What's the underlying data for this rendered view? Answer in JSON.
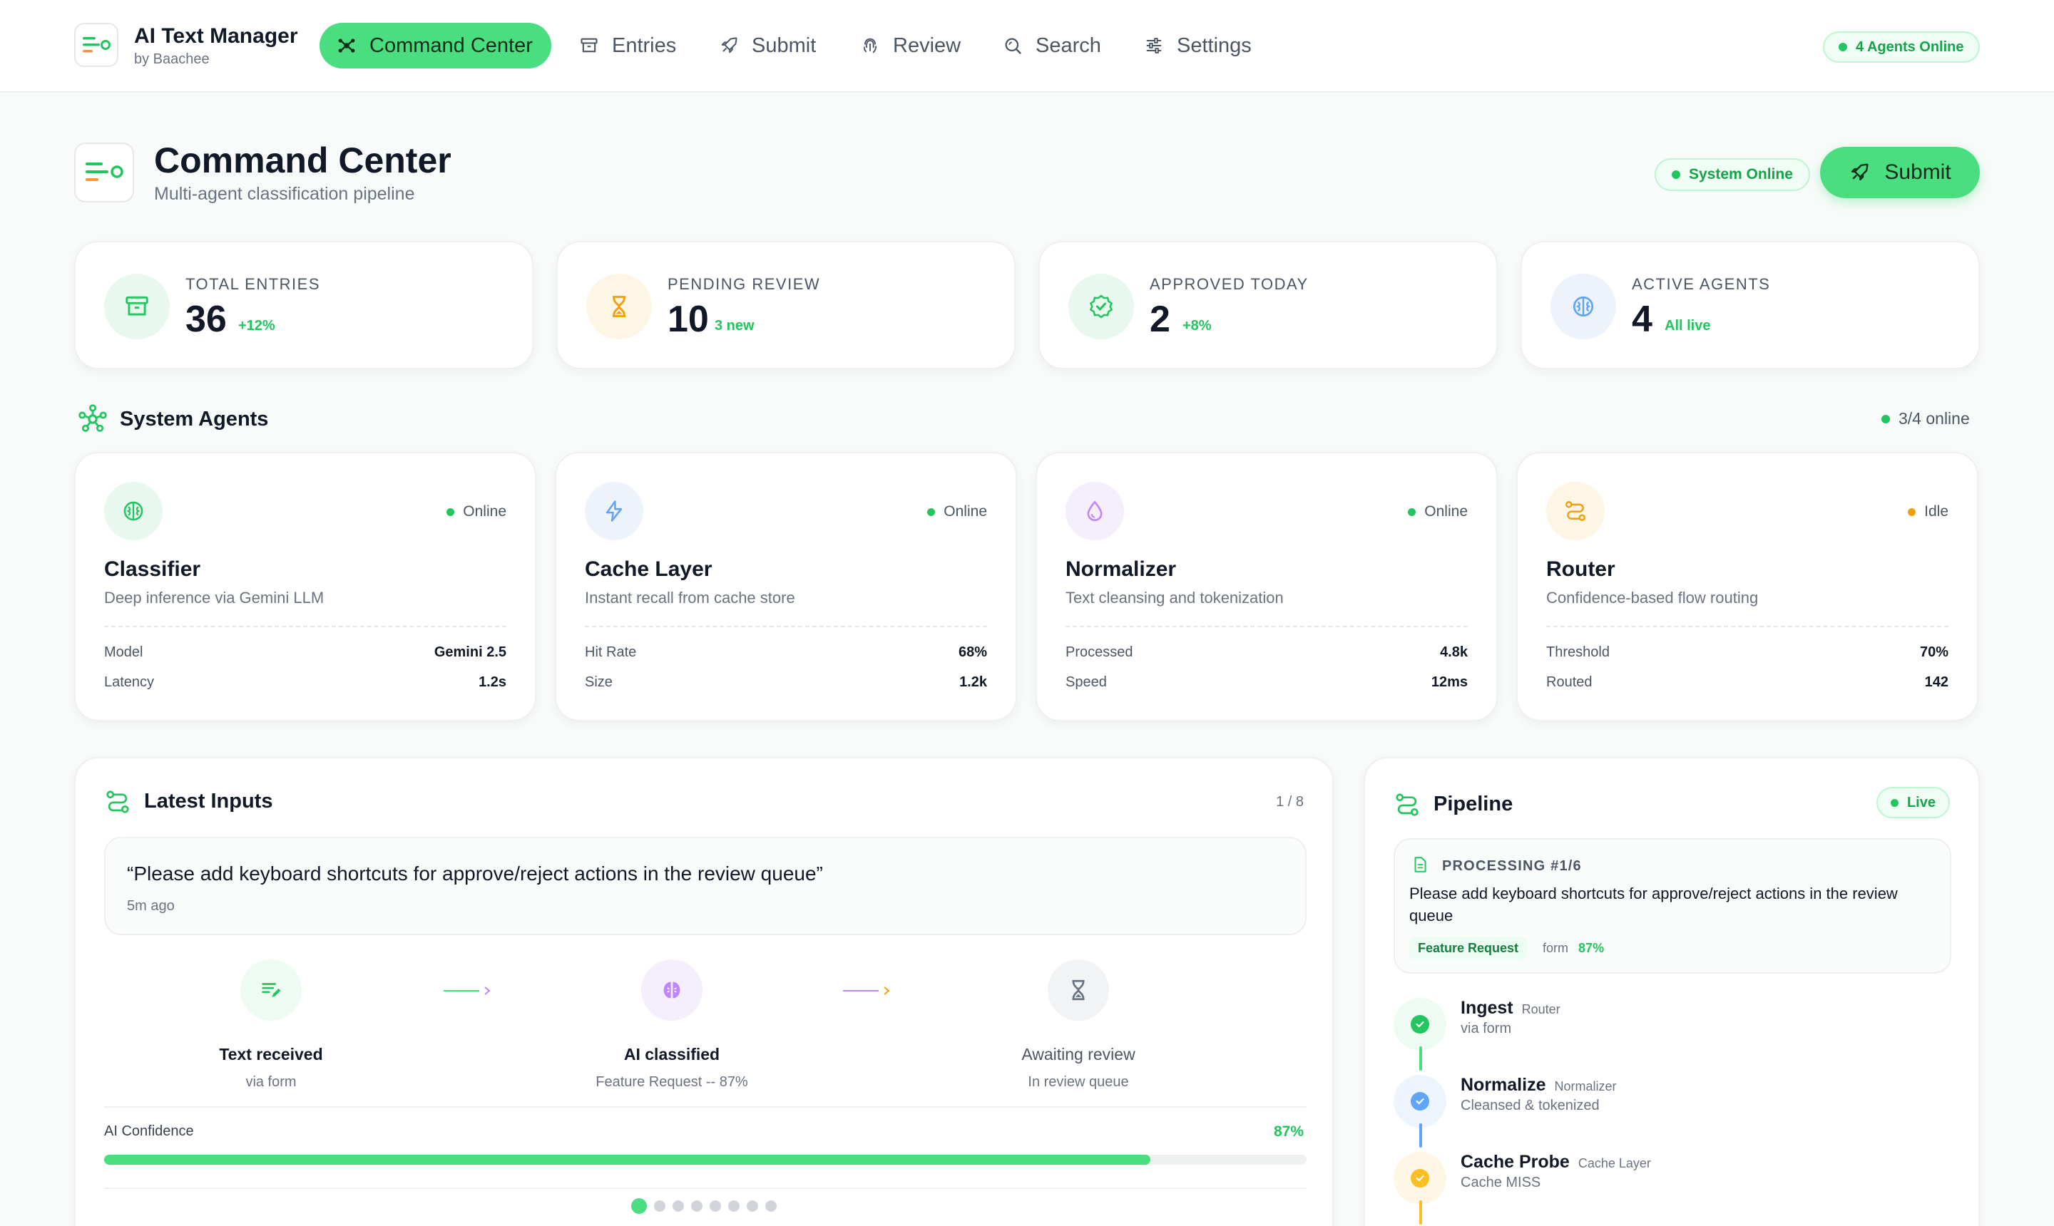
{
  "app": {
    "title": "AI Text Manager",
    "subtitle": "by Baachee"
  },
  "nav": {
    "items": [
      {
        "label": "Command Center",
        "icon": "hub-icon",
        "active": true
      },
      {
        "label": "Entries",
        "icon": "archive-icon"
      },
      {
        "label": "Submit",
        "icon": "rocket-icon"
      },
      {
        "label": "Review",
        "icon": "fingerprint-icon"
      },
      {
        "label": "Search",
        "icon": "search-icon"
      },
      {
        "label": "Settings",
        "icon": "sliders-icon"
      }
    ],
    "agents_online": "4 Agents Online"
  },
  "header": {
    "title": "Command Center",
    "subtitle": "Multi-agent classification pipeline",
    "system_status": "System Online",
    "submit_label": "Submit"
  },
  "stats": [
    {
      "label": "TOTAL ENTRIES",
      "value": "36",
      "delta": "+12%",
      "icon": "archive-icon"
    },
    {
      "label": "PENDING REVIEW",
      "value": "10",
      "delta": "3 new",
      "icon": "hourglass-icon"
    },
    {
      "label": "APPROVED TODAY",
      "value": "2",
      "delta": "+8%",
      "icon": "badge-check-icon"
    },
    {
      "label": "ACTIVE AGENTS",
      "value": "4",
      "delta": "All live",
      "icon": "brain-icon"
    }
  ],
  "agents_section": {
    "title": "System Agents",
    "online_count": "3/4 online"
  },
  "agents": [
    {
      "name": "Classifier",
      "desc": "Deep inference via Gemini LLM",
      "status": "Online",
      "status_color": "#22c55e",
      "rows": [
        {
          "k": "Model",
          "v": "Gemini 2.5"
        },
        {
          "k": "Latency",
          "v": "1.2s"
        }
      ]
    },
    {
      "name": "Cache Layer",
      "desc": "Instant recall from cache store",
      "status": "Online",
      "status_color": "#22c55e",
      "rows": [
        {
          "k": "Hit Rate",
          "v": "68%"
        },
        {
          "k": "Size",
          "v": "1.2k"
        }
      ]
    },
    {
      "name": "Normalizer",
      "desc": "Text cleansing and tokenization",
      "status": "Online",
      "status_color": "#22c55e",
      "rows": [
        {
          "k": "Processed",
          "v": "4.8k"
        },
        {
          "k": "Speed",
          "v": "12ms"
        }
      ]
    },
    {
      "name": "Router",
      "desc": "Confidence-based flow routing",
      "status": "Idle",
      "status_color": "#f59e0b",
      "rows": [
        {
          "k": "Threshold",
          "v": "70%"
        },
        {
          "k": "Routed",
          "v": "142"
        }
      ]
    }
  ],
  "latest": {
    "title": "Latest Inputs",
    "pager": "1 / 8",
    "quote": "“Please add keyboard shortcuts for approve/reject actions in the review queue”",
    "time": "5m ago",
    "steps": [
      {
        "title": "Text received",
        "sub": "via form"
      },
      {
        "title": "AI classified",
        "sub": "Feature Request -- 87%"
      },
      {
        "title": "Awaiting review",
        "sub": "In review queue"
      }
    ],
    "confidence_label": "AI Confidence",
    "confidence_value": "87%",
    "confidence": 0.87,
    "page_count": 8,
    "current_page": 1
  },
  "pipeline": {
    "title": "Pipeline",
    "live": "Live",
    "processing_label": "PROCESSING #1/6",
    "processing_text": "Please add keyboard shortcuts for approve/reject actions in the review queue",
    "tag": "Feature Request",
    "source": "form",
    "score": "87%",
    "stages": [
      {
        "name": "Ingest",
        "agent": "Router",
        "sub": "via form",
        "color": "#22c55e"
      },
      {
        "name": "Normalize",
        "agent": "Normalizer",
        "sub": "Cleansed & tokenized",
        "color": "#60a5fa"
      },
      {
        "name": "Cache Probe",
        "agent": "Cache Layer",
        "sub": "Cache MISS",
        "color": "#fbbf24"
      }
    ]
  },
  "colors": {
    "accent": "#4ade80",
    "accent_dark": "#22c55e",
    "purple": "#c084fc",
    "amber": "#f59e0b",
    "blue": "#60a5fa"
  }
}
